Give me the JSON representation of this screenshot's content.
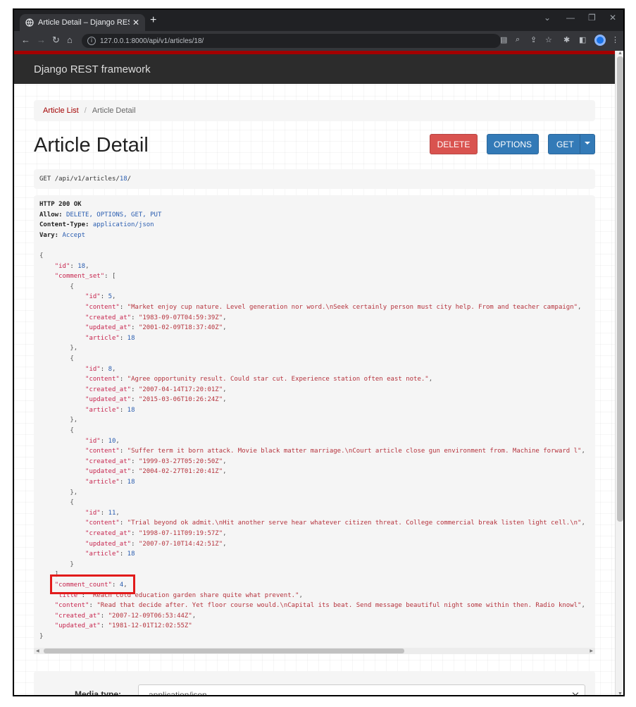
{
  "browser": {
    "tab_title": "Article Detail – Django REST fra",
    "url": "127.0.0.1:8000/api/v1/articles/18/"
  },
  "navbar": {
    "brand": "Django REST framework"
  },
  "breadcrumb": {
    "parent": "Article List",
    "separator": "/",
    "current": "Article Detail"
  },
  "page": {
    "title": "Article Detail"
  },
  "buttons": {
    "delete": "DELETE",
    "options": "OPTIONS",
    "get": "GET"
  },
  "request": {
    "method": "GET",
    "path": "/api/v1/articles/",
    "id": "18",
    "trail": "/"
  },
  "response_headers": [
    {
      "key": "HTTP 200 OK",
      "value": ""
    },
    {
      "key": "Allow:",
      "value": "DELETE, OPTIONS, GET, PUT"
    },
    {
      "key": "Content-Type:",
      "value": "application/json"
    },
    {
      "key": "Vary:",
      "value": "Accept"
    }
  ],
  "article": {
    "id": 18,
    "comment_set": [
      {
        "id": 5,
        "content": "Market enjoy cup nature. Level generation nor word.\\nSeek certainly person must city help. From and teacher campaign",
        "created_at": "1983-09-07T04:59:39Z",
        "updated_at": "2001-02-09T18:37:40Z",
        "article": 18
      },
      {
        "id": 8,
        "content": "Agree opportunity result. Could star cut. Experience station often east note.",
        "created_at": "2007-04-14T17:20:01Z",
        "updated_at": "2015-03-06T10:26:24Z",
        "article": 18
      },
      {
        "id": 10,
        "content": "Suffer term it born attack. Movie black matter marriage.\\nCourt article close gun environment from. Machine forward l",
        "created_at": "1999-03-27T05:20:50Z",
        "updated_at": "2004-02-27T01:20:41Z",
        "article": 18
      },
      {
        "id": 11,
        "content": "Trial beyond ok admit.\\nHit another serve hear whatever citizen threat. College commercial break listen light cell.\\n",
        "created_at": "1998-07-11T09:19:57Z",
        "updated_at": "2007-07-10T14:42:51Z",
        "article": 18
      }
    ],
    "comment_count": 4,
    "title": "Reach cold education garden share quite what prevent.",
    "content": "Read that decide after. Yet floor course would.\\nCapital its beat. Send message beautiful night some within then. Radio knowl",
    "created_at": "2007-12-09T06:53:44Z",
    "updated_at": "1981-12-01T12:02:55Z"
  },
  "form": {
    "media_label": "Media type:",
    "media_value": "application/json"
  }
}
